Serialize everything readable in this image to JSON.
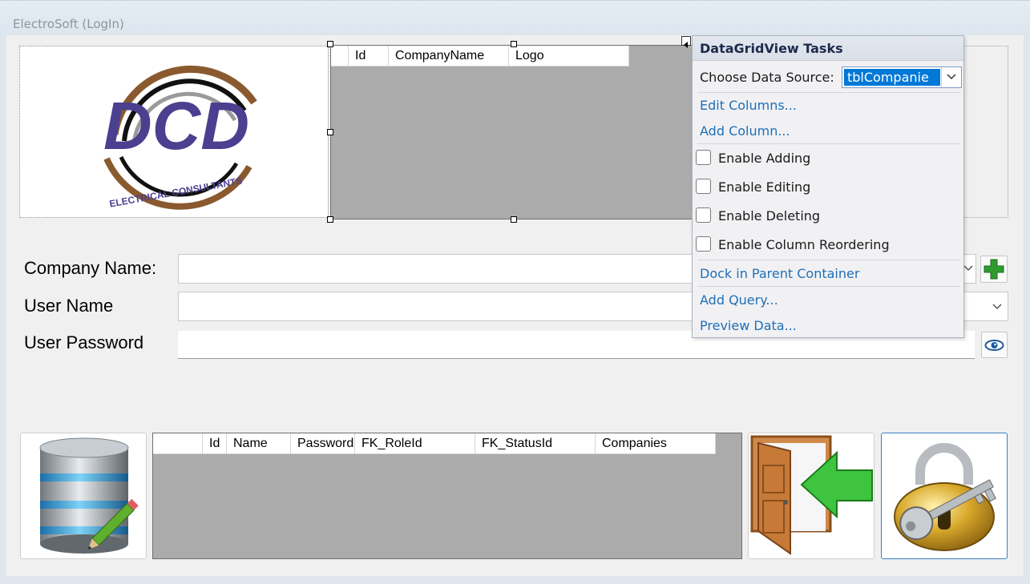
{
  "window": {
    "title": "ElectroSoft (LogIn)"
  },
  "logo": {
    "letters": "DCD",
    "arc_text": "ELECTRICAL CONSULTANTS"
  },
  "company_grid": {
    "columns": [
      "Id",
      "CompanyName",
      "Logo"
    ]
  },
  "form": {
    "company_label": "Company Name:",
    "user_label": "User Name",
    "password_label": "User Password",
    "company_value": "",
    "user_value": "",
    "password_value": ""
  },
  "users_grid": {
    "columns": [
      "Id",
      "Name",
      "Password",
      "FK_RoleId",
      "FK_StatusId",
      "Companies"
    ]
  },
  "tasks": {
    "title": "DataGridView Tasks",
    "data_source_label": "Choose Data Source:",
    "data_source_value": "tblCompanie",
    "edit_columns": "Edit Columns...",
    "add_column": "Add Column...",
    "enable_adding": "Enable Adding",
    "enable_editing": "Enable Editing",
    "enable_deleting": "Enable Deleting",
    "enable_reordering": "Enable Column Reordering",
    "dock": "Dock in Parent Container",
    "add_query": "Add Query...",
    "preview": "Preview Data..."
  },
  "colors": {
    "logo_purple": "#4b3f8f",
    "logo_brown": "#8a5a2e",
    "selection_blue": "#0078d7",
    "link_blue": "#1f6fb5"
  },
  "icons": [
    "plus-icon",
    "eye-icon",
    "database-edit-icon",
    "exit-door-icon",
    "padlock-key-icon",
    "dropdown-arrow-icon",
    "smart-tag-icon"
  ]
}
